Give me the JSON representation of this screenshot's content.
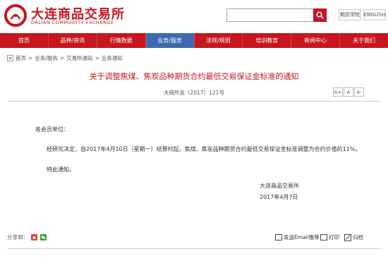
{
  "header": {
    "brand_cn": "大连商品交易所",
    "brand_en": "DALIAN COMMODITY EXCHANGE",
    "search_placeholder": "",
    "links": [
      "期货学院",
      "ENGLISH"
    ]
  },
  "nav": {
    "items": [
      "首页",
      "品种/资讯",
      "行情数据",
      "业务/服务",
      "法规/规则",
      "培训教育",
      "新闻中心",
      "关于我们"
    ],
    "active_index": 3
  },
  "breadcrumb": [
    "首页",
    "业务/服务",
    "交易所通知",
    "业务通知"
  ],
  "breadcrumb_sep": ">",
  "article": {
    "title": "关于调整焦煤、焦炭品种期货合约最低交易保证金标准的通知",
    "doc_no": "大商所发〔2017〕121号",
    "font_buttons": [
      "A+",
      "A",
      "A-"
    ],
    "salutation": "各会员单位：",
    "paragraph": "经研究决定，自2017年4月10日（星期一）结算时起，焦煤、焦炭品种期货合约最低交易保证金标准调整为合约价值的11%。",
    "closing": "特此通知。",
    "signature": "大连商品交易所",
    "date": "2017年4月7日"
  },
  "footer": {
    "share_label": "分享到：",
    "email_label": "发送Email推荐",
    "print_label": "打印",
    "close_label": "归档"
  },
  "colors": {
    "brand_red": "#c8161d",
    "nav_active": "#3e6bb0"
  }
}
